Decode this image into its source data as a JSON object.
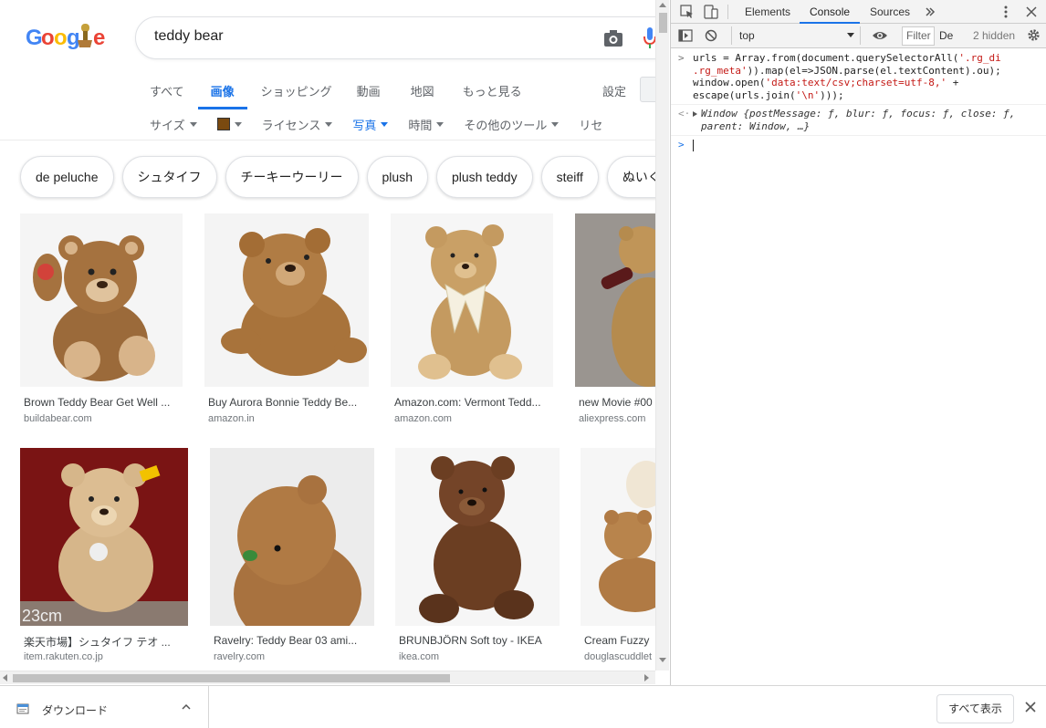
{
  "search": {
    "query": "teddy bear"
  },
  "tabs": [
    {
      "label": "すべて",
      "active": false
    },
    {
      "label": "画像",
      "active": true
    },
    {
      "label": "ショッピング",
      "active": false
    },
    {
      "label": "動画",
      "active": false
    },
    {
      "label": "地図",
      "active": false
    },
    {
      "label": "もっと見る",
      "active": false
    }
  ],
  "settings_label": "設定",
  "tools": [
    {
      "label": "サイズ"
    },
    {
      "label": "",
      "swatch": "#7a4a10"
    },
    {
      "label": "ライセンス"
    },
    {
      "label": "写真",
      "active": true
    },
    {
      "label": "時間"
    },
    {
      "label": "その他のツール"
    },
    {
      "label": "リセ"
    }
  ],
  "chips": [
    "de peluche",
    "シュタイフ",
    "チーキーウーリー",
    "plush",
    "plush teddy",
    "steiff",
    "ぬいぐる"
  ],
  "results": [
    {
      "caption": "Brown Teddy Bear Get Well ...",
      "domain": "buildabear.com"
    },
    {
      "caption": "Buy Aurora Bonnie Teddy Be...",
      "domain": "amazon.in"
    },
    {
      "caption": "Amazon.com: Vermont Tedd...",
      "domain": "amazon.com"
    },
    {
      "caption": "new Movie #00",
      "domain": "aliexpress.com"
    },
    {
      "caption": "楽天市場】シュタイフ テオ ...",
      "domain": "item.rakuten.co.jp"
    },
    {
      "caption": "Ravelry: Teddy Bear 03 ami...",
      "domain": "ravelry.com"
    },
    {
      "caption": "BRUNBJÖRN Soft toy - IKEA",
      "domain": "ikea.com"
    },
    {
      "caption": "Cream Fuzzy",
      "domain": "douglascuddlet"
    }
  ],
  "thumb_overlay_text": "23cm",
  "devtools": {
    "tabs": [
      "Elements",
      "Console",
      "Sources"
    ],
    "active_tab": "Console",
    "context": "top",
    "filter_placeholder": "Filter",
    "level": "De",
    "hidden": "2 hidden",
    "console_lines": {
      "l1a": "urls = Array.from(document.querySelectorAll(",
      "l1s": "'.rg_di",
      "l2s": ".rg_meta'",
      "l2b": ")).map(el=>JSON.parse(el.textContent).ou);",
      "l3a": "window.open(",
      "l3s": "'data:text/csv;charset=utf-8,'",
      "l3b": " +",
      "l4a": "escape(urls.join(",
      "l4s": "'\\n'",
      "l4b": ")));",
      "r1": "Window {postMessage: ƒ, blur: ƒ, focus: ƒ, close: ƒ,",
      "r2": "parent: Window, …}"
    }
  },
  "download_bar": {
    "item_label": "ダウンロード",
    "show_all": "すべて表示"
  },
  "colors": {
    "accent": "#1a73e8",
    "string": "#c41a16"
  }
}
